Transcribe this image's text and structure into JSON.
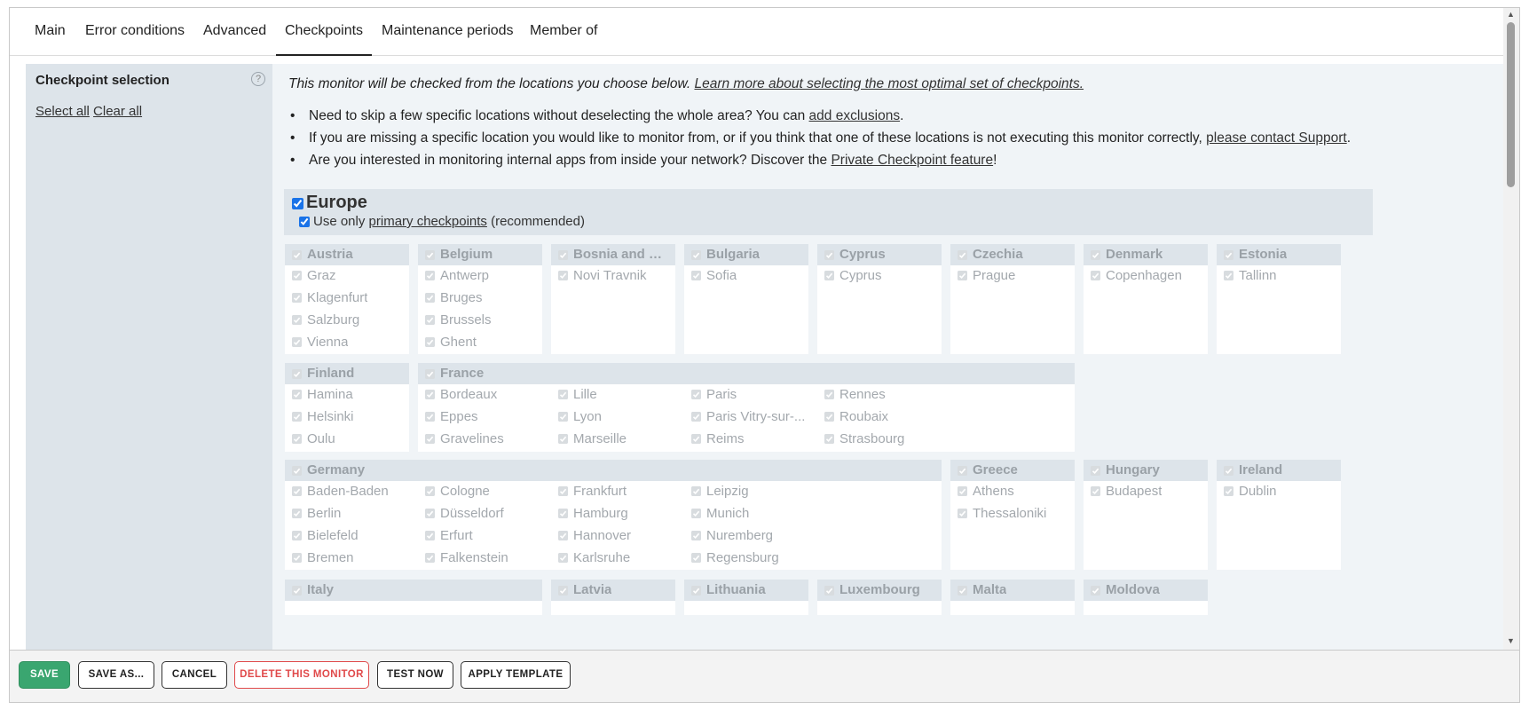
{
  "tabs": [
    "Main",
    "Error conditions",
    "Advanced",
    "Checkpoints",
    "Maintenance periods",
    "Member of"
  ],
  "active_tab": "Checkpoints",
  "sidebar": {
    "title": "Checkpoint selection",
    "select_all": "Select all",
    "clear_all": "Clear all",
    "help_icon": "question-circle-icon"
  },
  "intro": {
    "text": "This monitor will be checked from the locations you choose below. ",
    "link": "Learn more about selecting the most optimal set of checkpoints."
  },
  "bullets": [
    {
      "before": "Need to skip a few specific locations without deselecting the whole area? You can ",
      "link": "add exclusions",
      "after": "."
    },
    {
      "before": "If you are missing a specific location you would like to monitor from, or if you think that one of these locations is not executing this monitor correctly, ",
      "link": "please contact Support",
      "after": "."
    },
    {
      "before": "Are you interested in monitoring internal apps from inside your network? Discover the ",
      "link": "Private Checkpoint feature",
      "after": "!"
    }
  ],
  "region": {
    "name": "Europe",
    "checked": true,
    "primary_before": "Use only ",
    "primary_link": "primary checkpoints",
    "primary_after": " (recommended)",
    "primary_checked": true
  },
  "countries": [
    {
      "name": "Austria",
      "cities": [
        "Graz",
        "Klagenfurt",
        "Salzburg",
        "Vienna"
      ]
    },
    {
      "name": "Belgium",
      "cities": [
        "Antwerp",
        "Bruges",
        "Brussels",
        "Ghent"
      ]
    },
    {
      "name": "Bosnia and Her...",
      "cities": [
        "Novi Travnik"
      ]
    },
    {
      "name": "Bulgaria",
      "cities": [
        "Sofia"
      ]
    },
    {
      "name": "Cyprus",
      "cities": [
        "Cyprus"
      ]
    },
    {
      "name": "Czechia",
      "cities": [
        "Prague"
      ]
    },
    {
      "name": "Denmark",
      "cities": [
        "Copenhagen"
      ]
    },
    {
      "name": "Estonia",
      "cities": [
        "Tallinn"
      ]
    },
    {
      "name": "Finland",
      "cities": [
        "Hamina",
        "Helsinki",
        "Oulu"
      ]
    },
    {
      "name": "France",
      "cities": [
        "Bordeaux",
        "Eppes",
        "Gravelines",
        "Lille",
        "Lyon",
        "Marseille",
        "Paris",
        "Paris Vitry-sur-...",
        "Reims",
        "Rennes",
        "Roubaix",
        "Strasbourg"
      ]
    },
    {
      "name": "Germany",
      "cities": [
        "Baden-Baden",
        "Berlin",
        "Bielefeld",
        "Bremen",
        "Cologne",
        "Düsseldorf",
        "Erfurt",
        "Falkenstein",
        "Frankfurt",
        "Hamburg",
        "Hannover",
        "Karlsruhe",
        "Leipzig",
        "Munich",
        "Nuremberg",
        "Regensburg"
      ]
    },
    {
      "name": "Greece",
      "cities": [
        "Athens",
        "Thessaloniki"
      ]
    },
    {
      "name": "Hungary",
      "cities": [
        "Budapest"
      ]
    },
    {
      "name": "Ireland",
      "cities": [
        "Dublin"
      ]
    },
    {
      "name": "Italy",
      "cities": []
    },
    {
      "name": "Latvia",
      "cities": []
    },
    {
      "name": "Lithuania",
      "cities": []
    },
    {
      "name": "Luxembourg",
      "cities": []
    },
    {
      "name": "Malta",
      "cities": []
    },
    {
      "name": "Moldova",
      "cities": []
    }
  ],
  "footer": {
    "save": "SAVE",
    "save_as": "SAVE AS...",
    "cancel": "CANCEL",
    "delete": "DELETE THIS MONITOR",
    "test_now": "TEST NOW",
    "apply_template": "APPLY TEMPLATE"
  },
  "colors": {
    "accent": "#3aa670",
    "danger": "#e0494a",
    "panel": "#dde4ea",
    "main_bg": "#f0f4f7"
  }
}
